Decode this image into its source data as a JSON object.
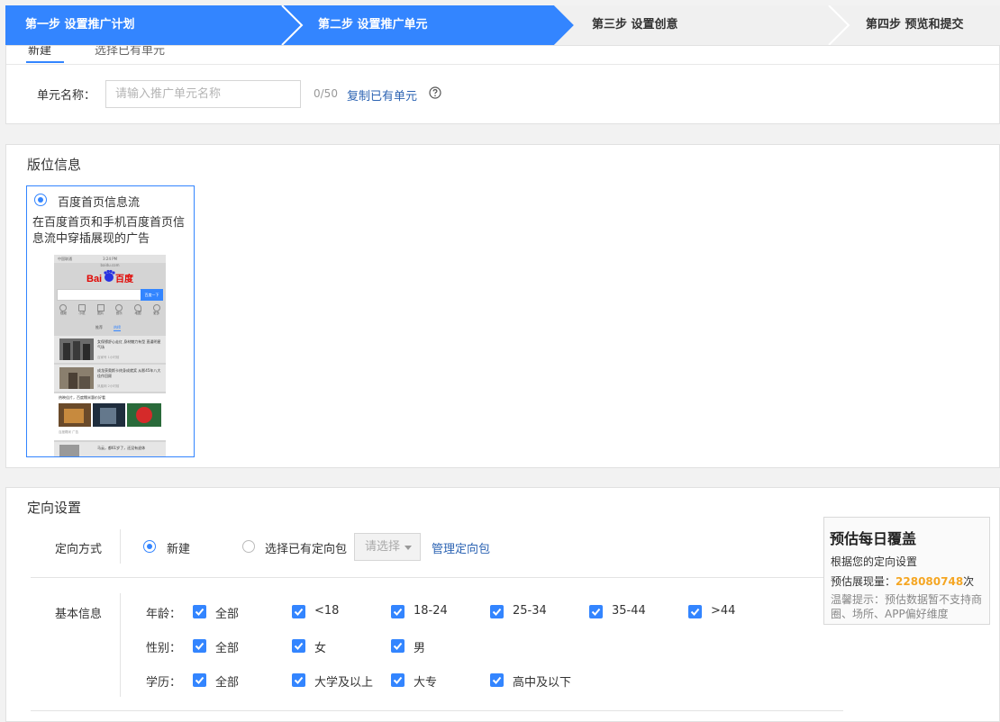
{
  "steps": [
    {
      "label": "第一步 设置推广计划",
      "state": "done"
    },
    {
      "label": "第二步 设置推广单元",
      "state": "active"
    },
    {
      "label": "第三步 设置创意",
      "state": "todo"
    },
    {
      "label": "第四步 预览和提交",
      "state": "todo"
    }
  ],
  "colors": {
    "accent": "#3385ff",
    "step_active": "#3385ff",
    "step_inactive": "#f0f0f0",
    "link": "#2d64b3",
    "highlight_number": "#f5a623"
  },
  "unit": {
    "tab_primary": "新建",
    "tab_secondary": "选择已有单元",
    "name_label": "单元名称：",
    "name_placeholder": "请输入推广单元名称",
    "name_value": "",
    "counter": "0/50",
    "copy_link": "复制已有单元",
    "help_icon": "question-circle-icon"
  },
  "placement": {
    "section_title": "版位信息",
    "option_title": "百度首页信息流",
    "option_desc": "在百度首页和手机百度首页信息流中穿插展现的广告",
    "option_selected": true,
    "preview": {
      "status_carrier": "中国联通",
      "status_time": "3:24 PM",
      "status_url": "baidu.com",
      "logo_text": "百度",
      "search_button": "百度一下",
      "nav_items": [
        "视频",
        "小说",
        "图片",
        "音乐",
        "地图",
        "更多"
      ],
      "tab_a": "推荐",
      "tab_b": "热榜",
      "news": [
        {
          "title": "女保镖舒心走红 身材魅力有型 直逼明星气场",
          "meta": "百家号 1小时前"
        },
        {
          "title": "成龙获奥斯卡终身成就奖 从影45年八大佳作回顾",
          "meta": "凤凰网 2小时前"
        }
      ],
      "promo_title": "热映佳片，百度糯米惠价好看",
      "promo_meta": "百度糯米 广告",
      "last_title": "马云，都61岁了，还没有退休"
    }
  },
  "targeting": {
    "section_title": "定向设置",
    "method_label": "定向方式",
    "method_new": "新建",
    "method_existing": "选择已有定向包",
    "select_placeholder": "请选择",
    "manage_link": "管理定向包",
    "basic_label": "基本信息",
    "age_label": "年龄：",
    "age_options": [
      "全部",
      "<18",
      "18-24",
      "25-34",
      "35-44",
      ">44"
    ],
    "gender_label": "性别：",
    "gender_options": [
      "全部",
      "女",
      "男"
    ],
    "edu_label": "学历：",
    "edu_options": [
      "全部",
      "大学及以上",
      "大专",
      "高中及以下"
    ]
  },
  "estimate": {
    "title": "预估每日覆盖",
    "subtitle": "根据您的定向设置",
    "impressions_label": "预估展现量：",
    "impressions_value": "228080748",
    "impressions_unit": "次",
    "tip": "温馨提示：预估数据暂不支持商圈、场所、APP偏好维度"
  }
}
